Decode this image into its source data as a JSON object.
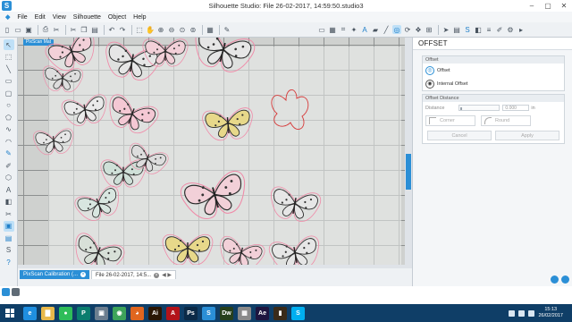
{
  "window": {
    "title": "Silhouette Studio: File 26-02-2017, 14:59:50.studio3",
    "app_icon": "S",
    "controls": [
      "–",
      "▢",
      "✕"
    ]
  },
  "menu": {
    "items": [
      "File",
      "Edit",
      "View",
      "Silhouette",
      "Object",
      "Help"
    ]
  },
  "toolbar": {
    "icons": [
      "new-doc-icon",
      "open-icon",
      "save-icon",
      "sep",
      "print-icon",
      "cut-send-icon",
      "sep",
      "cut-icon",
      "copy-icon",
      "paste-icon",
      "sep",
      "undo-icon",
      "redo-icon",
      "sep",
      "select-icon",
      "pan-icon",
      "zoom-in-icon",
      "zoom-out-icon",
      "zoom-fit-icon",
      "zoom-page-icon",
      "sep",
      "grid-icon",
      "sep",
      "draw-icon"
    ],
    "right_icons": [
      "page-setup-icon",
      "grid-settings-icon",
      "registration-icon",
      "cut-settings-icon",
      "text-style-icon",
      "fill-icon",
      "line-icon",
      "transform-icon",
      "replicate-icon",
      "offset-icon",
      "trace-icon",
      "send-icon",
      "library-icon",
      "store-icon",
      "design-icon"
    ]
  },
  "left_tools": [
    "select-tool-icon",
    "point-edit-icon",
    "line-tool-icon",
    "rect-tool-icon",
    "rounded-rect-icon",
    "ellipse-tool-icon",
    "polygon-tool-icon",
    "curve-tool-icon",
    "arc-tool-icon",
    "freehand-tool-icon",
    "smooth-freehand-icon",
    "polygon-shape-icon",
    "text-tool-icon",
    "eraser-tool-icon",
    "knife-tool-icon",
    "media-icon",
    "library-icon",
    "store-icon",
    "help-icon"
  ],
  "canvas": {
    "mat_label": "PixScan Mat"
  },
  "tabs": [
    {
      "label": "PixScan Calibration (...",
      "active": true,
      "close": "×"
    },
    {
      "label": "File 26-02-2017, 14:5...",
      "active": false,
      "close": "×"
    }
  ],
  "tab_nav": "◀ ▶",
  "panel": {
    "title": "OFFSET",
    "offset_section": "Offset",
    "options": [
      {
        "label": "Offset",
        "icon": "offset-icon",
        "selected": true
      },
      {
        "label": "Internal Offset",
        "icon": "internal-offset-icon",
        "selected": false
      }
    ],
    "distance_section": "Offset Distance",
    "distance_label": "Distance",
    "distance_value": "0.000",
    "distance_unit": "in",
    "corner_label": "Corner",
    "round_label": "Round",
    "cancel_label": "Cancel",
    "apply_label": "Apply"
  },
  "taskbar": {
    "apps": [
      {
        "name": "ie-icon",
        "label": "e",
        "color": "#1f8fe0"
      },
      {
        "name": "explorer-icon",
        "label": "▇",
        "color": "#e8b84a"
      },
      {
        "name": "spotify-icon",
        "label": "●",
        "color": "#2ebd59"
      },
      {
        "name": "publisher-icon",
        "label": "P",
        "color": "#0a7d6e"
      },
      {
        "name": "photos-icon",
        "label": "▣",
        "color": "#6c7e8f"
      },
      {
        "name": "chrome-icon",
        "label": "◉",
        "color": "#3da35a"
      },
      {
        "name": "firefox-icon",
        "label": "◕",
        "color": "#e0661f"
      },
      {
        "name": "illustrator-icon",
        "label": "Ai",
        "color": "#2a1603"
      },
      {
        "name": "acrobat-icon",
        "label": "A",
        "color": "#b3131a"
      },
      {
        "name": "photoshop-icon",
        "label": "Ps",
        "color": "#0b2a47"
      },
      {
        "name": "silhouette-icon",
        "label": "S",
        "color": "#2b8fd6"
      },
      {
        "name": "dreamweaver-icon",
        "label": "Dw",
        "color": "#27401c"
      },
      {
        "name": "photos2-icon",
        "label": "▦",
        "color": "#8a8a8a"
      },
      {
        "name": "after-effects-icon",
        "label": "Ae",
        "color": "#1e1640"
      },
      {
        "name": "media-icon",
        "label": "▮",
        "color": "#3a2b1a"
      },
      {
        "name": "skype-icon",
        "label": "S",
        "color": "#00aff0"
      }
    ],
    "time": "15:13",
    "date": "26/02/2017"
  },
  "colors": {
    "accent": "#2b8fd6",
    "taskbar": "#0f3e67"
  }
}
